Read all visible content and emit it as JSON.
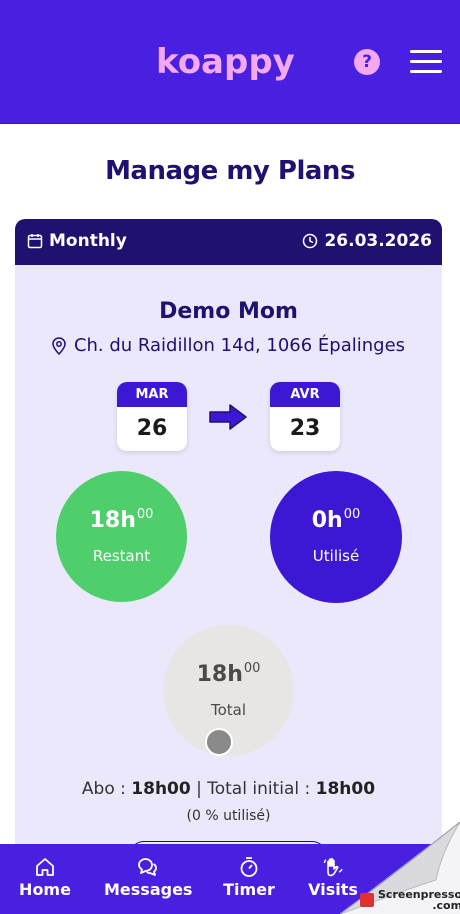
{
  "app": {
    "logo": "koappy",
    "help_icon": "question-icon",
    "menu_icon": "hamburger-icon"
  },
  "page": {
    "title": "Manage my Plans"
  },
  "plan": {
    "type": "Monthly",
    "date": "26.03.2026",
    "client": "Demo Mom",
    "address": "Ch. du Raidillon 14d, 1066 Épalinges",
    "from": {
      "month": "MAR",
      "day": "26"
    },
    "to": {
      "month": "AVR",
      "day": "23"
    },
    "remaining": {
      "hours": "18h",
      "minutes": "00",
      "label": "Restant"
    },
    "used": {
      "hours": "0h",
      "minutes": "00",
      "label": "Utilisé"
    },
    "total": {
      "hours": "18h",
      "minutes": "00",
      "label": "Total"
    },
    "summary": {
      "abo_label": "Abo : ",
      "abo_value": "18h00",
      "separator": " | Total initial : ",
      "initial_value": "18h00"
    },
    "percent_text": "(0 % utilisé)"
  },
  "colors": {
    "brand": "#4a20e0",
    "dark": "#1f1170",
    "pink": "#f3a8f0",
    "green": "#4fcf6c",
    "card_bg": "#ebe8fb"
  },
  "nav": {
    "items": [
      {
        "label": "Home",
        "icon": "home-icon"
      },
      {
        "label": "Messages",
        "icon": "chat-icon"
      },
      {
        "label": "Timer",
        "icon": "stopwatch-icon"
      },
      {
        "label": "Visits",
        "icon": "hand-wave-icon"
      }
    ]
  },
  "watermark": {
    "line1": "Screenpresso",
    "line2": ".com"
  }
}
